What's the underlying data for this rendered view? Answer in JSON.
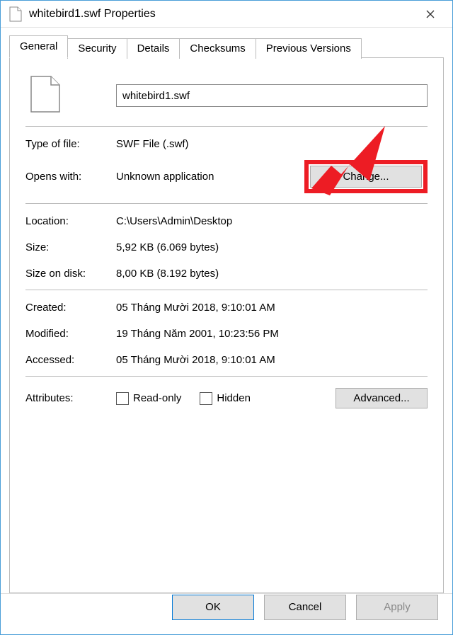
{
  "window": {
    "title": "whitebird1.swf Properties"
  },
  "tabs": [
    "General",
    "Security",
    "Details",
    "Checksums",
    "Previous Versions"
  ],
  "activeTabIndex": 0,
  "filename": "whitebird1.swf",
  "fields": {
    "type_label": "Type of file:",
    "type_value": "SWF File (.swf)",
    "opens_label": "Opens with:",
    "opens_value": "Unknown application",
    "change_button": "Change...",
    "location_label": "Location:",
    "location_value": "C:\\Users\\Admin\\Desktop",
    "size_label": "Size:",
    "size_value": "5,92 KB (6.069 bytes)",
    "sizeondisk_label": "Size on disk:",
    "sizeondisk_value": "8,00 KB (8.192 bytes)",
    "created_label": "Created:",
    "created_value": "05 Tháng Mười 2018, 9:10:01 AM",
    "modified_label": "Modified:",
    "modified_value": "19 Tháng Năm 2001, 10:23:56 PM",
    "accessed_label": "Accessed:",
    "accessed_value": "05 Tháng Mười 2018, 9:10:01 AM",
    "attributes_label": "Attributes:",
    "readonly_label": "Read-only",
    "hidden_label": "Hidden",
    "advanced_button": "Advanced..."
  },
  "footer": {
    "ok": "OK",
    "cancel": "Cancel",
    "apply": "Apply"
  },
  "highlight_color": "#ed1c24"
}
